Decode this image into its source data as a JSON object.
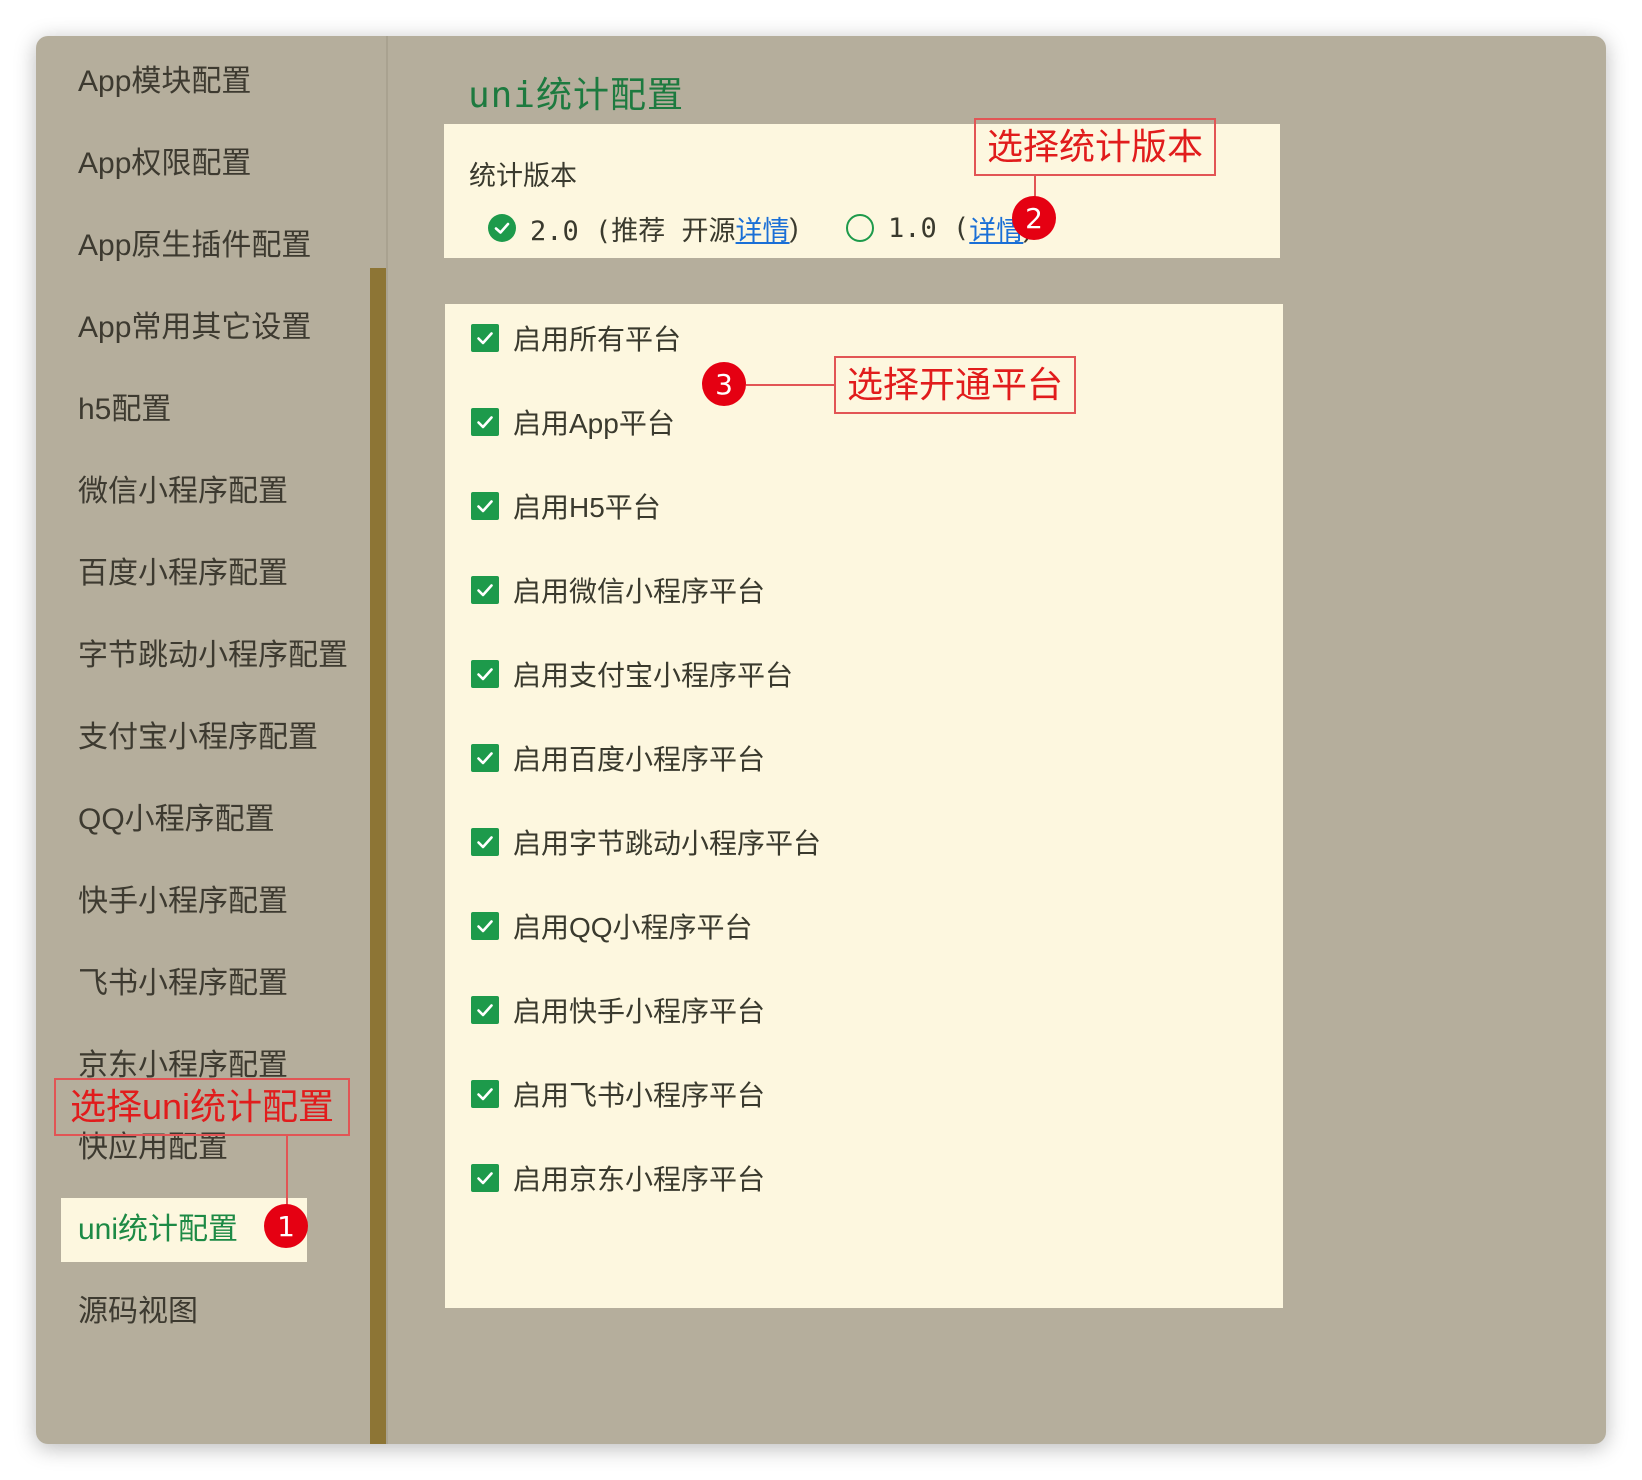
{
  "sidebar": {
    "items": [
      {
        "label": "App模块配置"
      },
      {
        "label": "App权限配置"
      },
      {
        "label": "App原生插件配置"
      },
      {
        "label": "App常用其它设置"
      },
      {
        "label": "h5配置"
      },
      {
        "label": "微信小程序配置"
      },
      {
        "label": "百度小程序配置"
      },
      {
        "label": "字节跳动小程序配置"
      },
      {
        "label": "支付宝小程序配置"
      },
      {
        "label": "QQ小程序配置"
      },
      {
        "label": "快手小程序配置"
      },
      {
        "label": "飞书小程序配置"
      },
      {
        "label": "京东小程序配置"
      },
      {
        "label": "快应用配置"
      },
      {
        "label": "uni统计配置",
        "active": true
      },
      {
        "label": "源码视图"
      }
    ]
  },
  "main": {
    "title": "uni统计配置",
    "version": {
      "label": "统计版本",
      "options": [
        {
          "text": "2.0 (推荐 开源 ",
          "link": "详情",
          "close": ")",
          "selected": true
        },
        {
          "text": "1.0 (",
          "link": "详情",
          "close": ")",
          "selected": false
        }
      ]
    },
    "platforms": [
      {
        "label": "启用所有平台",
        "checked": true
      },
      {
        "label": "启用App平台",
        "checked": true
      },
      {
        "label": "启用H5平台",
        "checked": true
      },
      {
        "label": "启用微信小程序平台",
        "checked": true
      },
      {
        "label": "启用支付宝小程序平台",
        "checked": true
      },
      {
        "label": "启用百度小程序平台",
        "checked": true
      },
      {
        "label": "启用字节跳动小程序平台",
        "checked": true
      },
      {
        "label": "启用QQ小程序平台",
        "checked": true
      },
      {
        "label": "启用快手小程序平台",
        "checked": true
      },
      {
        "label": "启用飞书小程序平台",
        "checked": true
      },
      {
        "label": "启用京东小程序平台",
        "checked": true
      }
    ]
  },
  "annotations": {
    "step1": {
      "number": "1",
      "text": "选择uni统计配置"
    },
    "step2": {
      "number": "2",
      "text": "选择统计版本"
    },
    "step3": {
      "number": "3",
      "text": "选择开通平台"
    }
  },
  "colors": {
    "background": "#b5ae9c",
    "panel": "#fdf7df",
    "accent_green": "#1d9a4b",
    "link_blue": "#1a6fd6",
    "annotation_red": "#e11c1c",
    "badge_red": "#e50012",
    "scrollbar": "#8d7535"
  }
}
